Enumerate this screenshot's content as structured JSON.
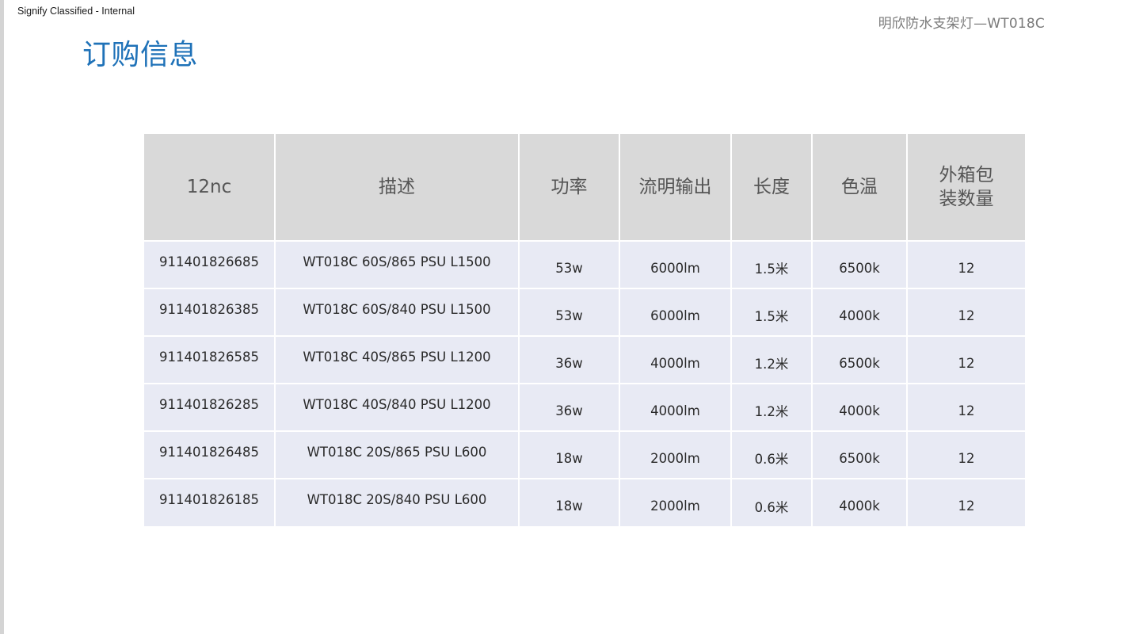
{
  "header": {
    "classification": "Signify Classified - Internal",
    "product_code": "明欣防水支架灯—WT018C",
    "title": "订购信息"
  },
  "table": {
    "columns": [
      "12nc",
      "描述",
      "功率",
      "流明输出",
      "长度",
      "色温",
      "外箱包",
      "装数量"
    ],
    "rows": [
      {
        "nc": "911401826685",
        "desc": "WT018C 60S/865 PSU L1500",
        "power": "53w",
        "lumen": "6000lm",
        "length": "1.5米",
        "cct": "6500k",
        "qty": "12"
      },
      {
        "nc": "911401826385",
        "desc": "WT018C 60S/840 PSU L1500",
        "power": "53w",
        "lumen": "6000lm",
        "length": "1.5米",
        "cct": "4000k",
        "qty": "12"
      },
      {
        "nc": "911401826585",
        "desc": "WT018C 40S/865 PSU L1200",
        "power": "36w",
        "lumen": "4000lm",
        "length": "1.2米",
        "cct": "6500k",
        "qty": "12"
      },
      {
        "nc": "911401826285",
        "desc": "WT018C 40S/840 PSU L1200",
        "power": "36w",
        "lumen": "4000lm",
        "length": "1.2米",
        "cct": "4000k",
        "qty": "12"
      },
      {
        "nc": "911401826485",
        "desc": "WT018C 20S/865 PSU L600",
        "power": "18w",
        "lumen": "2000lm",
        "length": "0.6米",
        "cct": "6500k",
        "qty": "12"
      },
      {
        "nc": "911401826185",
        "desc": "WT018C 20S/840 PSU L600",
        "power": "18w",
        "lumen": "2000lm",
        "length": "0.6米",
        "cct": "4000k",
        "qty": "12"
      }
    ]
  },
  "colors": {
    "title": "#1f72b8",
    "header_bg": "#d9d9d9",
    "row_bg": "#e8eaf4"
  }
}
